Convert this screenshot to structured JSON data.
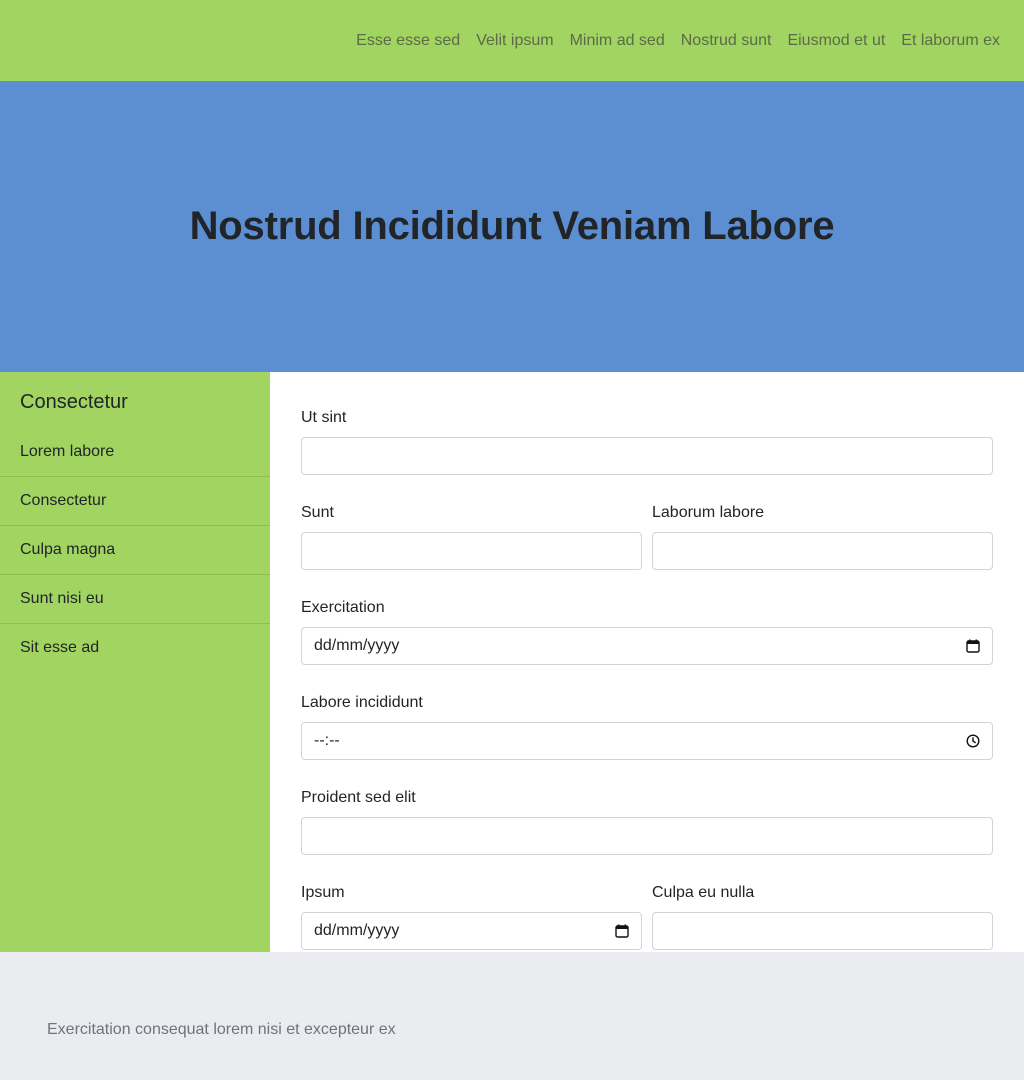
{
  "nav": {
    "items": [
      "Esse esse sed",
      "Velit ipsum",
      "Minim ad sed",
      "Nostrud sunt",
      "Eiusmod et ut",
      "Et laborum ex"
    ]
  },
  "hero": {
    "title": "Nostrud Incididunt Veniam Labore"
  },
  "sidebar": {
    "heading": "Consectetur",
    "items": [
      "Lorem labore",
      "Consectetur",
      "Culpa magna",
      "Sunt nisi eu",
      "Sit esse ad"
    ]
  },
  "form": {
    "ut_sint_label": "Ut sint",
    "sunt_label": "Sunt",
    "laborum_labore_label": "Laborum labore",
    "exercitation_label": "Exercitation",
    "exercitation_placeholder": "dd/mm/yyyy",
    "labore_incididunt_label": "Labore incididunt",
    "labore_incididunt_placeholder": "--:--",
    "proident_label": "Proident sed elit",
    "ipsum_label": "Ipsum",
    "ipsum_placeholder": "dd/mm/yyyy",
    "culpa_label": "Culpa eu nulla"
  },
  "footer": {
    "text": "Exercitation consequat lorem nisi et excepteur ex"
  },
  "colors": {
    "nav_bg": "#a1d461",
    "hero_bg": "#5c8fd2",
    "sidebar_bg": "#a1d461",
    "footer_bg": "#ebecef"
  },
  "icons": {
    "date": "calendar-icon",
    "time": "clock-icon"
  }
}
